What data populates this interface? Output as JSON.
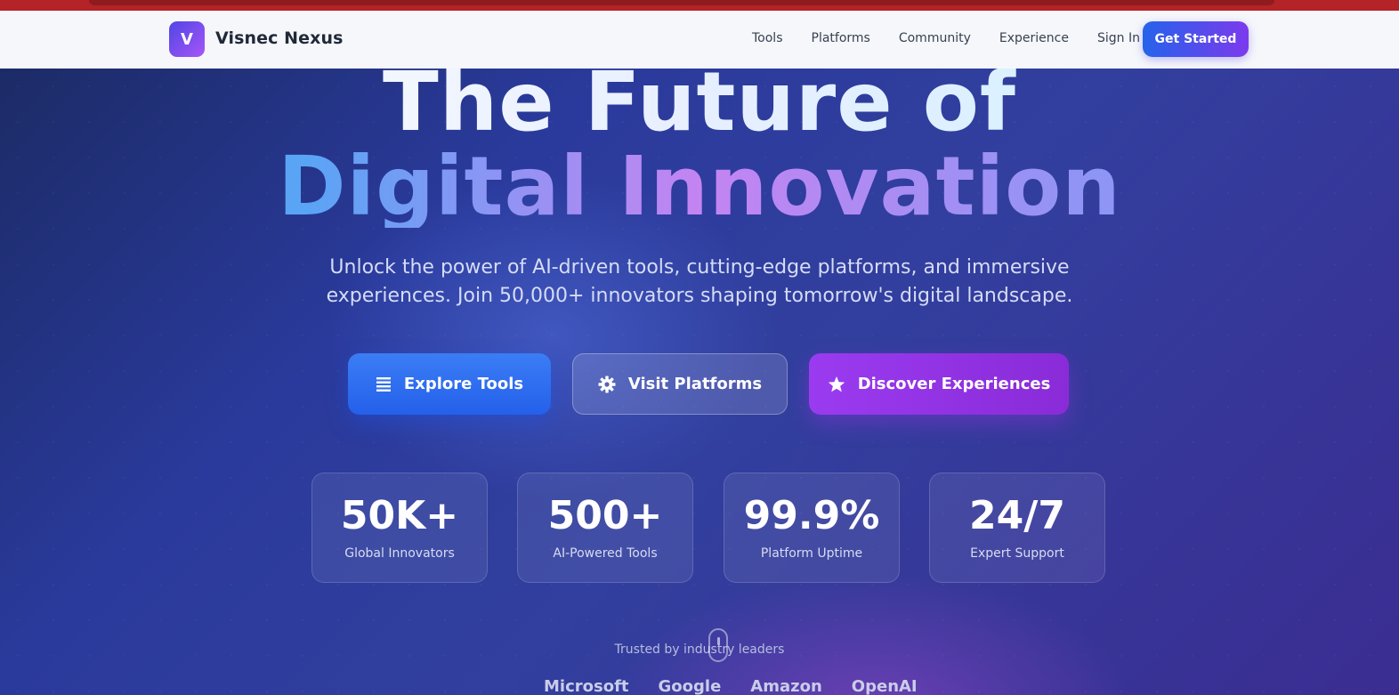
{
  "brand": {
    "logo_letter": "V",
    "name": "Visnec Nexus"
  },
  "nav": {
    "links": [
      "Tools",
      "Platforms",
      "Community",
      "Experience",
      "Sign In"
    ],
    "cta": "Get Started"
  },
  "hero": {
    "title_line1": "The Future of",
    "title_line2": "Digital Innovation",
    "subtitle_line1": "Unlock the power of AI-driven tools, cutting-edge platforms, and immersive",
    "subtitle_line2": "experiences. Join 50,000+ innovators shaping tomorrow's digital landscape.",
    "buttons": [
      {
        "label": "Explore Tools",
        "icon": "list-icon"
      },
      {
        "label": "Visit Platforms",
        "icon": "gear-icon"
      },
      {
        "label": "Discover Experiences",
        "icon": "star-icon"
      }
    ],
    "stats": [
      {
        "value": "50K+",
        "label": "Global Innovators"
      },
      {
        "value": "500+",
        "label": "AI-Powered Tools"
      },
      {
        "value": "99.9%",
        "label": "Platform Uptime"
      },
      {
        "value": "24/7",
        "label": "Expert Support"
      }
    ],
    "trusted_text": "Trusted by industry leaders",
    "partners": [
      "Microsoft",
      "Google",
      "Amazon",
      "OpenAI"
    ]
  },
  "colors": {
    "accent_blue": "#2563eb",
    "accent_purple": "#7c3aed",
    "browser_strip": "#b42327"
  }
}
